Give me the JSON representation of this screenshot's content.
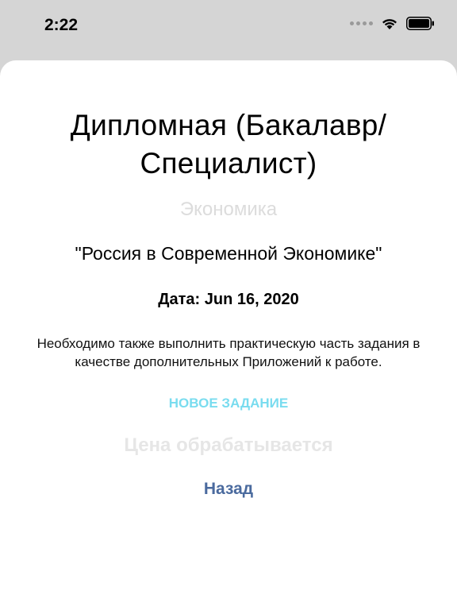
{
  "status_bar": {
    "time": "2:22",
    "icons": [
      "signal-dots-icon",
      "wifi-icon",
      "battery-icon"
    ]
  },
  "order": {
    "title": "Дипломная (Бакалавр/ Специалист)",
    "subject": "Экономика",
    "topic": "\"Россия в Современной Экономике\"",
    "date": "Дата: Jun 16, 2020",
    "note": "Необходимо также выполнить практическую часть задания в качестве дополнительных Приложений к работе.",
    "new_task_label": "НОВОЕ ЗАДАНИЕ",
    "price_status": "Цена обрабатывается",
    "back_label": "Назад"
  },
  "colors": {
    "backdrop": "#d5d5d5",
    "subject_gray": "#dcdcdc",
    "accent_cyan": "#79dcef",
    "back_blue": "#4a6a9e"
  }
}
